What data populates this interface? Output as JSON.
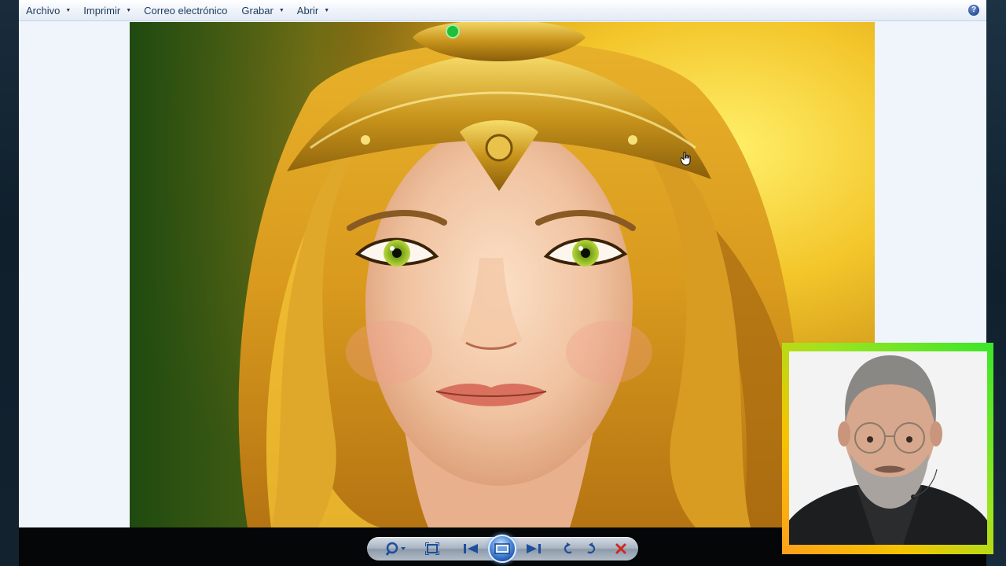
{
  "menubar": {
    "items": [
      {
        "label": "Archivo",
        "has_dropdown": true
      },
      {
        "label": "Imprimir",
        "has_dropdown": true
      },
      {
        "label": "Correo electrónico",
        "has_dropdown": false
      },
      {
        "label": "Grabar",
        "has_dropdown": true
      },
      {
        "label": "Abrir",
        "has_dropdown": true
      }
    ],
    "help_icon": "question-mark-icon",
    "help_label": "?"
  },
  "image": {
    "subject": "fantasy portrait of a woman with golden hair and a golden jeweled headdress",
    "dominant_colors": [
      "#f5c400",
      "#e0a21e",
      "#2d5a14",
      "#f0c8a8"
    ]
  },
  "controls": {
    "icons": [
      "zoom-icon",
      "fit-to-window-icon",
      "previous-icon",
      "slideshow-icon",
      "next-icon",
      "rotate-counterclockwise-icon",
      "rotate-clockwise-icon",
      "delete-icon"
    ]
  },
  "webcam": {
    "border_colors": [
      "#ff9f1c",
      "#39e62a"
    ]
  }
}
